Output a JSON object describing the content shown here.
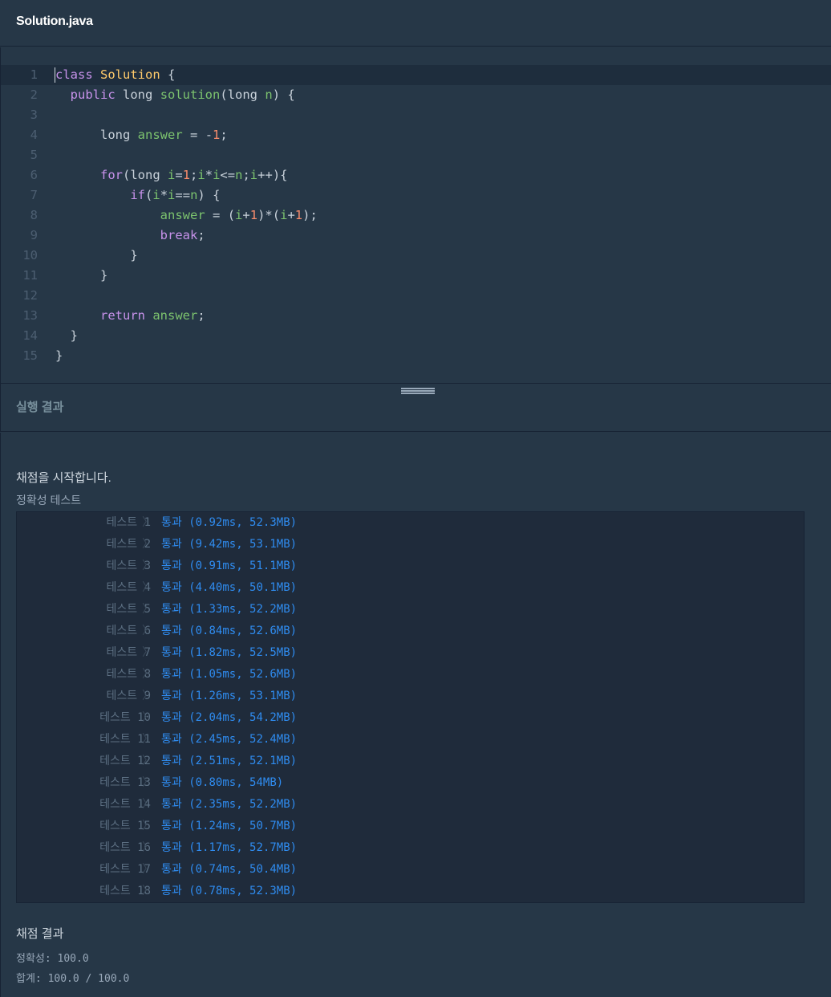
{
  "file_title": "Solution.java",
  "code_lines": [
    {
      "num": "1",
      "text": "class Solution {"
    },
    {
      "num": "2",
      "text": "  public long solution(long n) {"
    },
    {
      "num": "3",
      "text": ""
    },
    {
      "num": "4",
      "text": "      long answer = -1;"
    },
    {
      "num": "5",
      "text": ""
    },
    {
      "num": "6",
      "text": "      for(long i=1;i*i<=n;i++){"
    },
    {
      "num": "7",
      "text": "          if(i*i==n) {"
    },
    {
      "num": "8",
      "text": "              answer = (i+1)*(i+1);"
    },
    {
      "num": "9",
      "text": "              break;"
    },
    {
      "num": "10",
      "text": "          }"
    },
    {
      "num": "11",
      "text": "      }"
    },
    {
      "num": "12",
      "text": ""
    },
    {
      "num": "13",
      "text": "      return answer;"
    },
    {
      "num": "14",
      "text": "  }"
    },
    {
      "num": "15",
      "text": "}"
    }
  ],
  "result_title": "실행 결과",
  "console": {
    "start_message": "채점을 시작합니다.",
    "section_label": "정확성  테스트",
    "tests": [
      {
        "name": "테스트 1",
        "result": "통과 (0.92ms, 52.3MB)"
      },
      {
        "name": "테스트 2",
        "result": "통과 (9.42ms, 53.1MB)"
      },
      {
        "name": "테스트 3",
        "result": "통과 (0.91ms, 51.1MB)"
      },
      {
        "name": "테스트 4",
        "result": "통과 (4.40ms, 50.1MB)"
      },
      {
        "name": "테스트 5",
        "result": "통과 (1.33ms, 52.2MB)"
      },
      {
        "name": "테스트 6",
        "result": "통과 (0.84ms, 52.6MB)"
      },
      {
        "name": "테스트 7",
        "result": "통과 (1.82ms, 52.5MB)"
      },
      {
        "name": "테스트 8",
        "result": "통과 (1.05ms, 52.6MB)"
      },
      {
        "name": "테스트 9",
        "result": "통과 (1.26ms, 53.1MB)"
      },
      {
        "name": "테스트 10",
        "result": "통과 (2.04ms, 54.2MB)"
      },
      {
        "name": "테스트 11",
        "result": "통과 (2.45ms, 52.4MB)"
      },
      {
        "name": "테스트 12",
        "result": "통과 (2.51ms, 52.1MB)"
      },
      {
        "name": "테스트 13",
        "result": "통과 (0.80ms, 54MB)"
      },
      {
        "name": "테스트 14",
        "result": "통과 (2.35ms, 52.2MB)"
      },
      {
        "name": "테스트 15",
        "result": "통과 (1.24ms, 50.7MB)"
      },
      {
        "name": "테스트 16",
        "result": "통과 (1.17ms, 52.7MB)"
      },
      {
        "name": "테스트 17",
        "result": "통과 (0.74ms, 50.4MB)"
      },
      {
        "name": "테스트 18",
        "result": "통과 (0.78ms, 52.3MB)"
      }
    ],
    "chevron": "〉",
    "final_title": "채점 결과",
    "accuracy": "정확성: 100.0",
    "total": "합계: 100.0 / 100.0"
  },
  "colors": {
    "background": "#263747",
    "pass": "#2f8cf0",
    "keyword": "#c792ea",
    "class_name": "#ffcb6b",
    "identifier": "#7cc36e"
  }
}
